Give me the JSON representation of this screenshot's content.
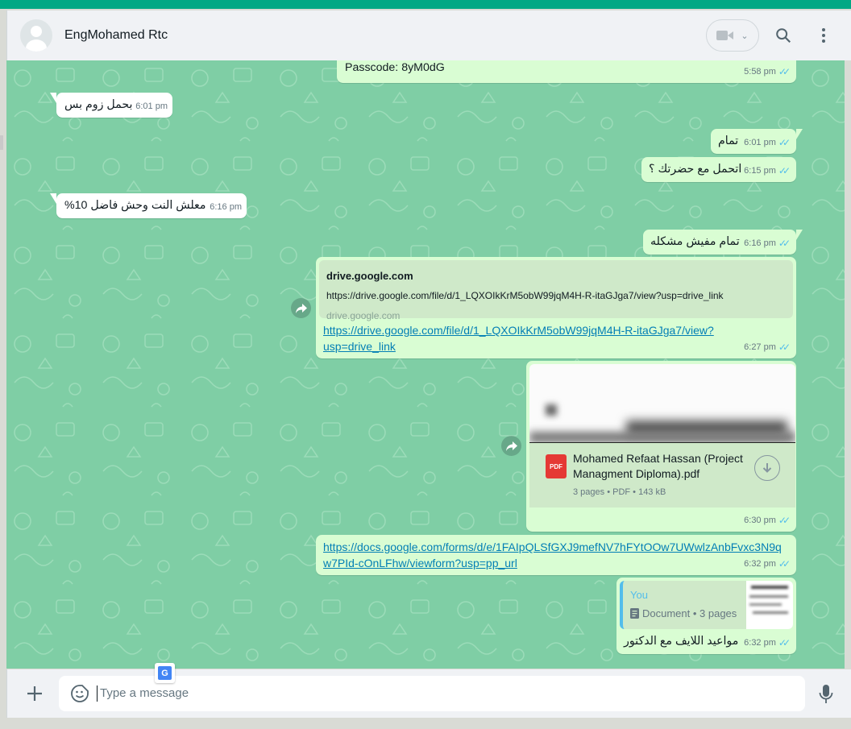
{
  "header": {
    "contact_name": "EngMohamed Rtc"
  },
  "messages": {
    "m0": {
      "text": "Passcode: 8yM0dG",
      "time": "5:58 pm"
    },
    "m1": {
      "text": "بحمل زوم بس",
      "time": "6:01 pm"
    },
    "m2": {
      "text": "تمام",
      "time": "6:01 pm"
    },
    "m3": {
      "text": "اتحمل مع حضرتك ؟",
      "time": "6:15 pm"
    },
    "m4": {
      "text": "معلش النت وحش فاضل 10%",
      "time": "6:16 pm"
    },
    "m5": {
      "text": "تمام مفيش مشكله",
      "time": "6:16 pm"
    },
    "m6": {
      "preview_title": "drive.google.com",
      "preview_url": "https://drive.google.com/file/d/1_LQXOIkKrM5obW99jqM4H-R-itaGJga7/view?usp=drive_link",
      "preview_domain": "drive.google.com",
      "link_line1": "https://drive.google.com/file/d/1_LQXOIkKrM5obW99jqM4H-R-itaGJga7/view?",
      "link_line2": "usp=drive_link",
      "time": "6:27 pm"
    },
    "m7": {
      "file_name": "Mohamed Refaat Hassan (Project Managment Diploma).pdf",
      "file_meta": "3 pages • PDF • 143 kB",
      "file_badge": "PDF",
      "time": "6:30 pm"
    },
    "m8": {
      "link_line1": "https://docs.google.com/forms/d/e/1FAIpQLSfGXJ9mefNV7hFYtOOw7UWwlzAnbFvxc3N9q",
      "link_line2": "w7PId-cOnLFhw/viewform?usp=pp_url",
      "time": "6:32 pm"
    },
    "m9": {
      "quote_author": "You",
      "quote_text": "Document • 3 pages",
      "text": "مواعيد اللايف مع الدكتور",
      "time": "6:32 pm"
    }
  },
  "composer": {
    "placeholder": "Type a message"
  },
  "colors": {
    "accent": "#00a884",
    "chat_bg": "#7fcea5",
    "outgoing": "#d9fdd3",
    "incoming": "#ffffff",
    "tick_blue": "#53bdeb",
    "link": "#027eb5"
  },
  "icons": [
    "default-avatar",
    "video-call-icon",
    "chevron-down-icon",
    "search-icon",
    "menu-dots-icon",
    "forward-icon",
    "pdf-icon",
    "download-icon",
    "document-icon",
    "plus-icon",
    "sticker-icon",
    "mic-icon",
    "translate-icon"
  ]
}
